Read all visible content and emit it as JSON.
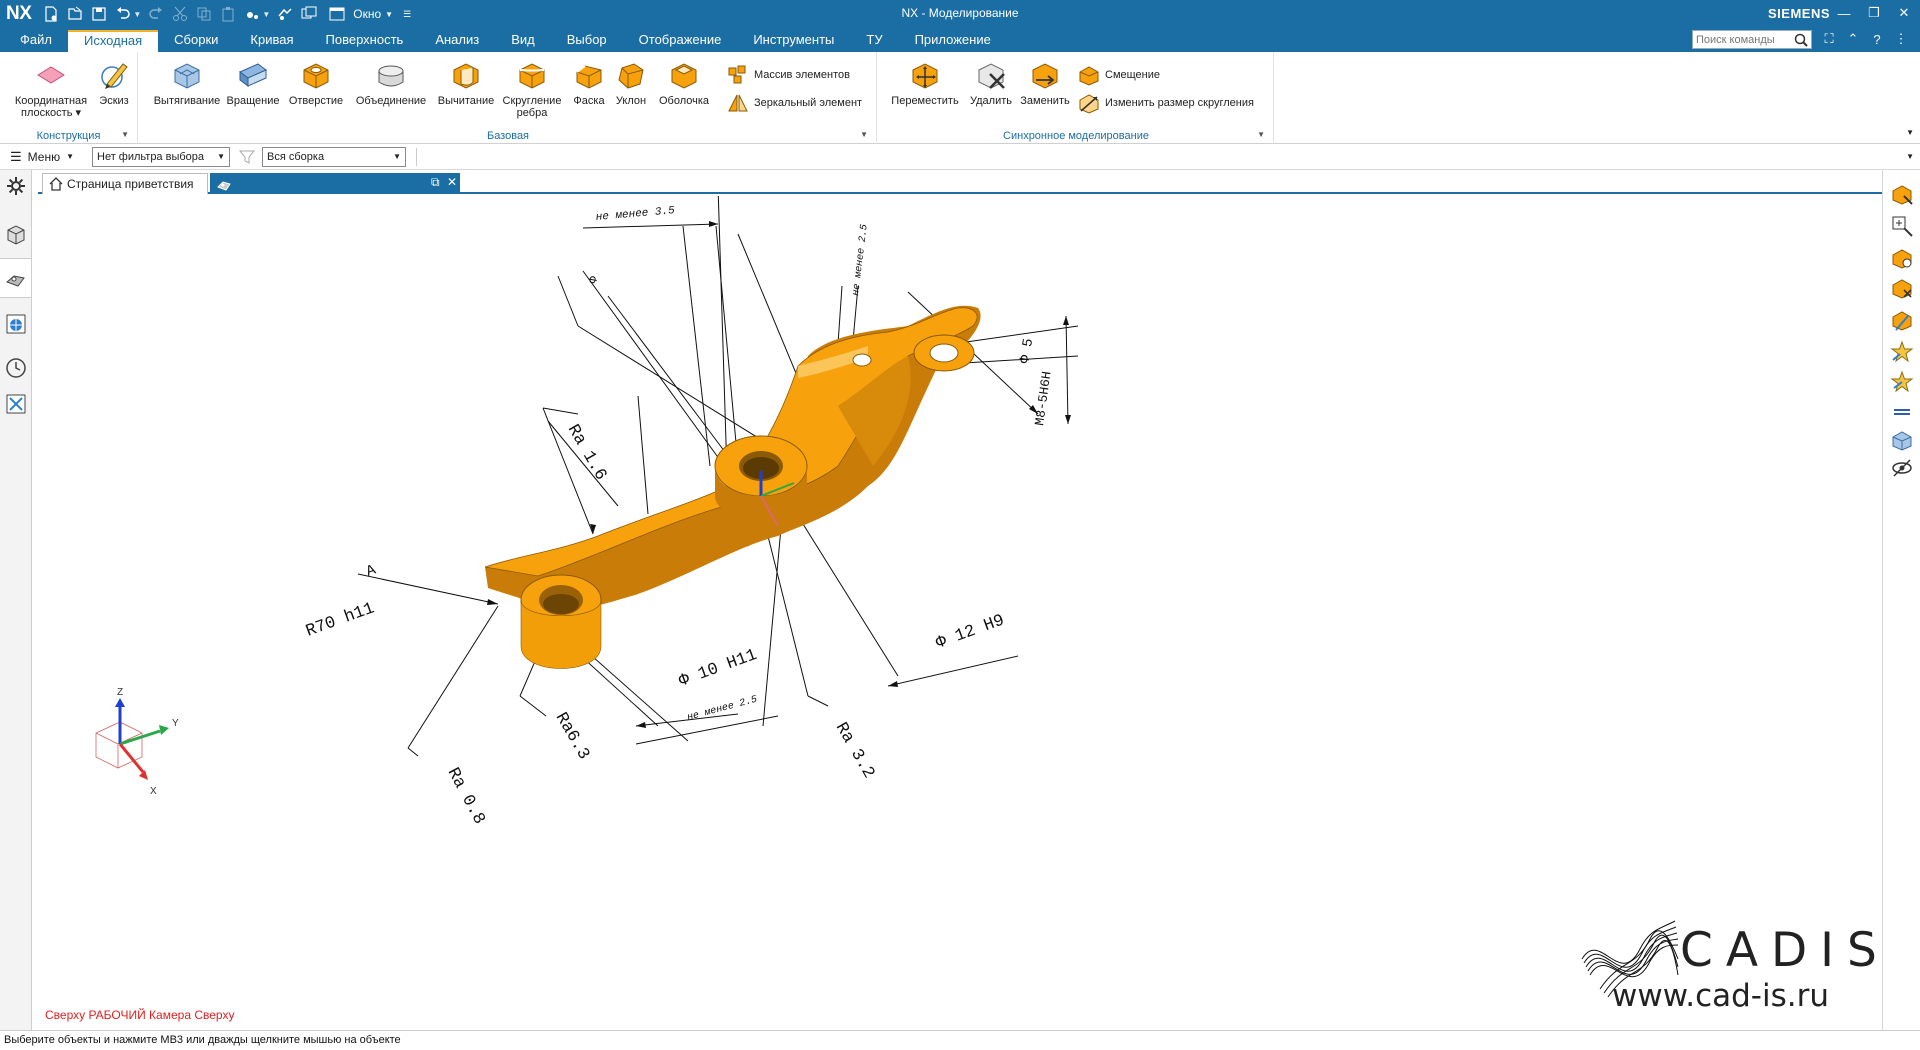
{
  "app": {
    "logo": "NX",
    "title": "NX - Моделирование",
    "brand": "SIEMENS",
    "window_menu": "Окно"
  },
  "tabs": [
    {
      "label": "Файл",
      "active": false
    },
    {
      "label": "Исходная",
      "active": true
    },
    {
      "label": "Сборки",
      "active": false
    },
    {
      "label": "Кривая",
      "active": false
    },
    {
      "label": "Поверхность",
      "active": false
    },
    {
      "label": "Анализ",
      "active": false
    },
    {
      "label": "Вид",
      "active": false
    },
    {
      "label": "Выбор",
      "active": false
    },
    {
      "label": "Отображение",
      "active": false
    },
    {
      "label": "Инструменты",
      "active": false
    },
    {
      "label": "ТУ",
      "active": false
    },
    {
      "label": "Приложение",
      "active": false
    }
  ],
  "search": {
    "placeholder": "Поиск команды"
  },
  "ribbon": {
    "construction": {
      "label": "Конструкция",
      "coord_plane_1": "Координатная",
      "coord_plane_2": "плоскость",
      "sketch": "Эскиз"
    },
    "base": {
      "label": "Базовая",
      "extrude": "Вытягивание",
      "revolve": "Вращение",
      "hole": "Отверстие",
      "unite": "Объединение",
      "subtract": "Вычитание",
      "edge_blend_1": "Скругление",
      "edge_blend_2": "ребра",
      "chamfer": "Фаска",
      "draft": "Уклон",
      "shell": "Оболочка",
      "pattern": "Массив элементов",
      "mirror": "Зеркальный элемент"
    },
    "sync": {
      "label": "Синхронное моделирование",
      "move": "Переместить",
      "delete": "Удалить",
      "replace": "Заменить",
      "offset": "Смещение",
      "resize_blend": "Изменить размер скругления"
    }
  },
  "selection_bar": {
    "menu": "Меню",
    "filter": "Нет фильтра выбора",
    "scope": "Вся сборка"
  },
  "doc_tabs": {
    "welcome": "Страница приветствия"
  },
  "viewport": {
    "view_label": "Сверху РАБОЧИЙ Камера Сверху",
    "triad": {
      "x": "X",
      "y": "Y",
      "z": "Z"
    },
    "annotations": {
      "ne_menee_35": "не менее 3.5",
      "ne_menee_25_top": "не менее 2.5",
      "ne_menee_25_bottom": "не менее 2.5",
      "ra16": "Ra 1.6",
      "ra32": "Ra 3.2",
      "ra63": "Ra6.3",
      "ra08": "Ra 0.8",
      "r70": "R70 h11",
      "d10": "Ф 10 H11",
      "d12": "Ф 12 H9",
      "d5": "Ф 5",
      "m8": "M8-5H6H",
      "a": "A",
      "phi_small": "Ф"
    },
    "colors": {
      "part": "#f7a10d",
      "part_dark": "#c97d08",
      "part_light": "#fbc55a"
    }
  },
  "watermark": {
    "company": "CADIS",
    "url": "www.cad-is.ru"
  },
  "status": {
    "text": "Выберите объекты и нажмите МВ3 или дважды щелкните мышью на объекте"
  }
}
